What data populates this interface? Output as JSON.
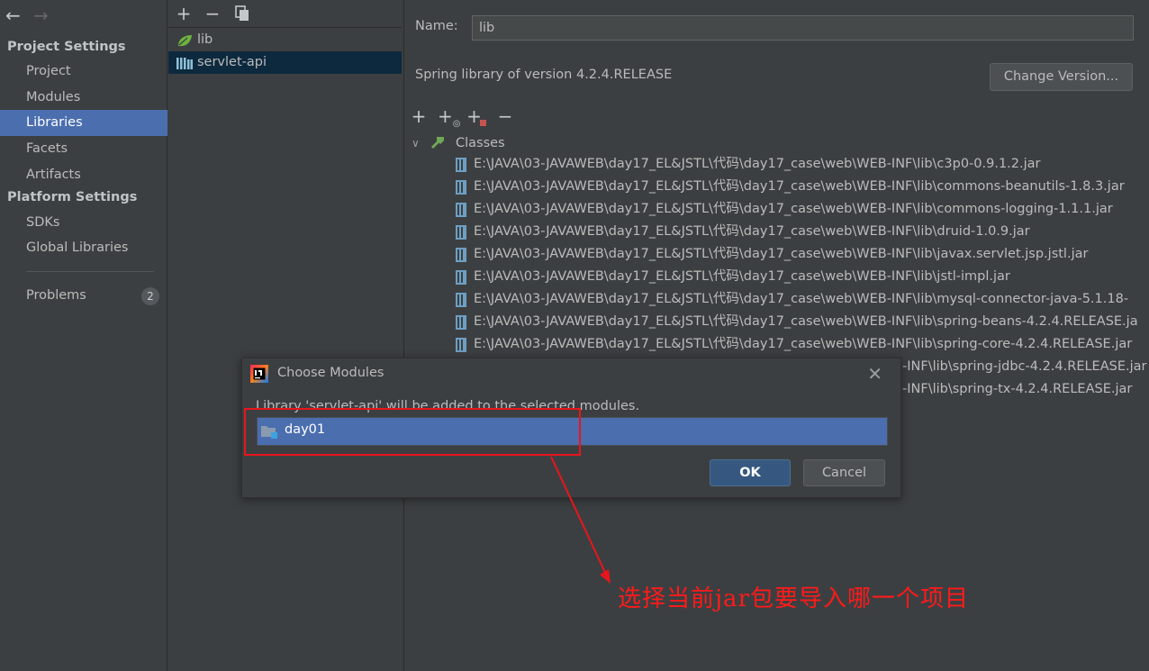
{
  "nav": {
    "project_settings_header": "Project Settings",
    "project_items": [
      "Project",
      "Modules",
      "Libraries",
      "Facets",
      "Artifacts"
    ],
    "platform_settings_header": "Platform Settings",
    "platform_items": [
      "SDKs",
      "Global Libraries"
    ],
    "problems_label": "Problems",
    "problems_count": "2",
    "selected_item": "Libraries"
  },
  "libraries": {
    "items": [
      "lib",
      "servlet-api"
    ],
    "selected": "servlet-api"
  },
  "details": {
    "name_label": "Name:",
    "name_value": "lib",
    "version_text": "Spring library of version 4.2.4.RELEASE",
    "change_version_button": "Change Version...",
    "classes_label": "Classes",
    "jars": [
      "E:\\JAVA\\03-JAVAWEB\\day17_EL&JSTL\\代码\\day17_case\\web\\WEB-INF\\lib\\c3p0-0.9.1.2.jar",
      "E:\\JAVA\\03-JAVAWEB\\day17_EL&JSTL\\代码\\day17_case\\web\\WEB-INF\\lib\\commons-beanutils-1.8.3.jar",
      "E:\\JAVA\\03-JAVAWEB\\day17_EL&JSTL\\代码\\day17_case\\web\\WEB-INF\\lib\\commons-logging-1.1.1.jar",
      "E:\\JAVA\\03-JAVAWEB\\day17_EL&JSTL\\代码\\day17_case\\web\\WEB-INF\\lib\\druid-1.0.9.jar",
      "E:\\JAVA\\03-JAVAWEB\\day17_EL&JSTL\\代码\\day17_case\\web\\WEB-INF\\lib\\javax.servlet.jsp.jstl.jar",
      "E:\\JAVA\\03-JAVAWEB\\day17_EL&JSTL\\代码\\day17_case\\web\\WEB-INF\\lib\\jstl-impl.jar",
      "E:\\JAVA\\03-JAVAWEB\\day17_EL&JSTL\\代码\\day17_case\\web\\WEB-INF\\lib\\mysql-connector-java-5.1.18-",
      "E:\\JAVA\\03-JAVAWEB\\day17_EL&JSTL\\代码\\day17_case\\web\\WEB-INF\\lib\\spring-beans-4.2.4.RELEASE.ja",
      "E:\\JAVA\\03-JAVAWEB\\day17_EL&JSTL\\代码\\day17_case\\web\\WEB-INF\\lib\\spring-core-4.2.4.RELEASE.jar",
      "-INF\\lib\\spring-jdbc-4.2.4.RELEASE.jar",
      "-INF\\lib\\spring-tx-4.2.4.RELEASE.jar"
    ]
  },
  "dialog": {
    "title": "Choose Modules",
    "message": "Library 'servlet-api' will be added to the selected modules.",
    "module": "day01",
    "ok_button": "OK",
    "cancel_button": "Cancel"
  },
  "annotation": {
    "text": "选择当前jar包要导入哪一个项目",
    "color": "#e8151c"
  },
  "colors": {
    "background": "#3c3f41",
    "selection": "#4b6eaf",
    "primary_button": "#365880"
  }
}
